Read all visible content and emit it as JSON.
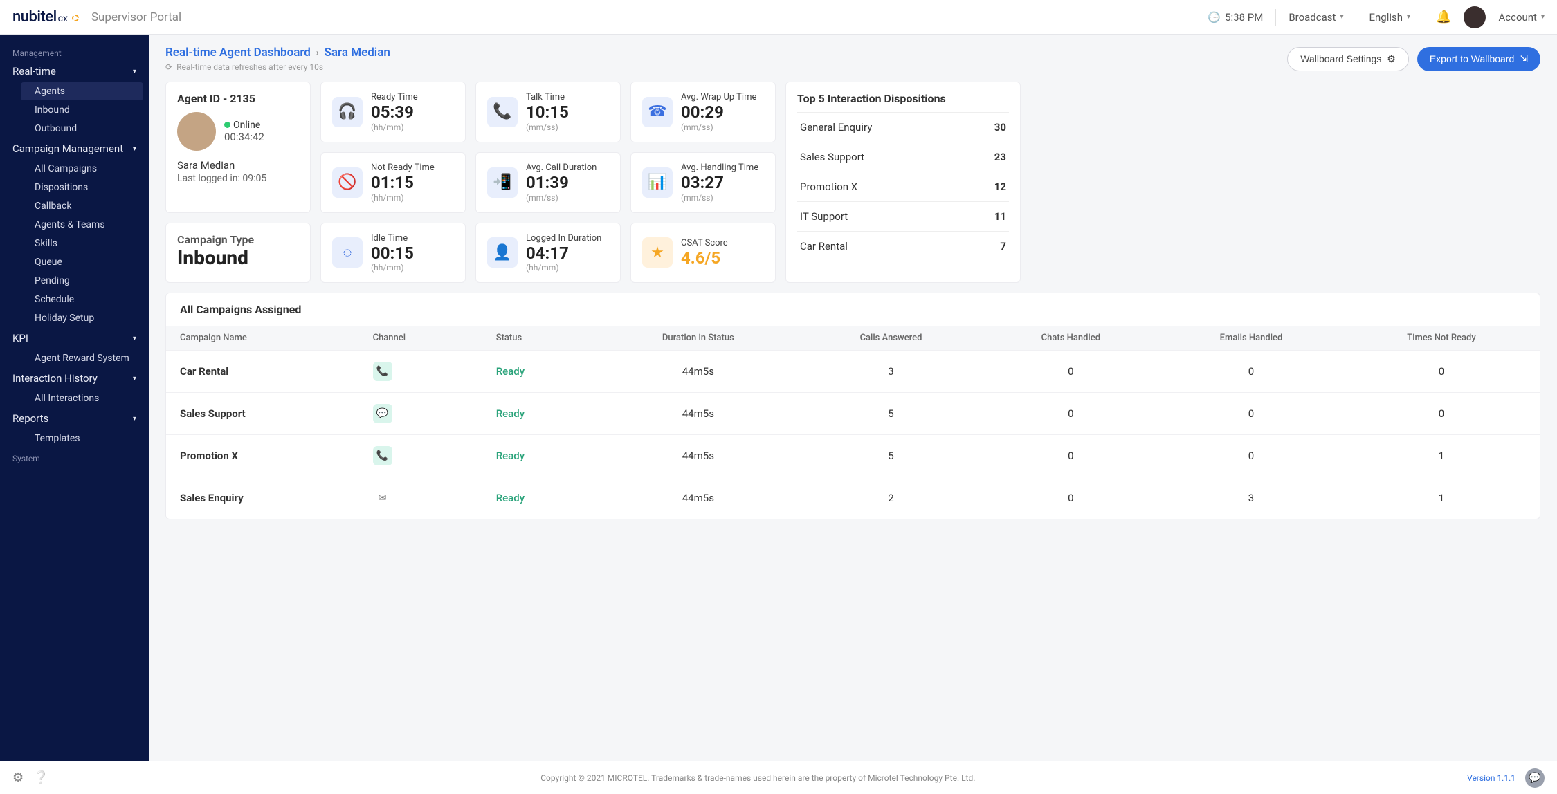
{
  "brand": {
    "name": "nubitel",
    "suffix": "cx"
  },
  "portal_name": "Supervisor Portal",
  "topbar": {
    "time": "5:38 PM",
    "broadcast": "Broadcast",
    "language": "English",
    "account": "Account"
  },
  "sidebar": {
    "section_management": "Management",
    "realtime": {
      "label": "Real-time",
      "items": [
        "Agents",
        "Inbound",
        "Outbound"
      ]
    },
    "campaign_mgmt": {
      "label": "Campaign Management",
      "items": [
        "All Campaigns",
        "Dispositions",
        "Callback",
        "Agents & Teams",
        "Skills",
        "Queue",
        "Pending",
        "Schedule",
        "Holiday Setup"
      ]
    },
    "kpi": {
      "label": "KPI",
      "items": [
        "Agent Reward System"
      ]
    },
    "interaction_history": {
      "label": "Interaction History",
      "items": [
        "All Interactions"
      ]
    },
    "reports": {
      "label": "Reports",
      "items": [
        "Templates"
      ]
    },
    "section_system": "System"
  },
  "breadcrumb": {
    "root": "Real-time Agent Dashboard",
    "leaf": "Sara Median"
  },
  "refresh_note": "Real-time data refreshes after every 10s",
  "actions": {
    "wallboard_settings": "Wallboard Settings",
    "export": "Export to Wallboard"
  },
  "agent": {
    "id_label": "Agent ID - 2135",
    "status": "Online",
    "status_duration": "00:34:42",
    "name": "Sara Median",
    "last_logged_label": "Last logged in: 09:05"
  },
  "campaign_type": {
    "label": "Campaign Type",
    "value": "Inbound"
  },
  "metrics": {
    "ready": {
      "label": "Ready Time",
      "value": "05:39",
      "unit": "(hh/mm)"
    },
    "talk": {
      "label": "Talk Time",
      "value": "10:15",
      "unit": "(mm/ss)"
    },
    "wrap": {
      "label": "Avg. Wrap Up Time",
      "value": "00:29",
      "unit": "(mm/ss)"
    },
    "notready": {
      "label": "Not Ready Time",
      "value": "01:15",
      "unit": "(hh/mm)"
    },
    "avgcall": {
      "label": "Avg. Call Duration",
      "value": "01:39",
      "unit": "(mm/ss)"
    },
    "avghandling": {
      "label": "Avg. Handling Time",
      "value": "03:27",
      "unit": "(mm/ss)"
    },
    "idle": {
      "label": "Idle Time",
      "value": "00:15",
      "unit": "(hh/mm)"
    },
    "loggedin": {
      "label": "Logged In Duration",
      "value": "04:17",
      "unit": "(hh/mm)"
    },
    "csat": {
      "label": "CSAT Score",
      "value": "4.6/5"
    }
  },
  "dispositions": {
    "title": "Top 5 Interaction Dispositions",
    "rows": [
      {
        "label": "General Enquiry",
        "value": "30"
      },
      {
        "label": "Sales Support",
        "value": "23"
      },
      {
        "label": "Promotion X",
        "value": "12"
      },
      {
        "label": "IT Support",
        "value": "11"
      },
      {
        "label": "Car Rental",
        "value": "7"
      }
    ]
  },
  "campaigns_table": {
    "title": "All Campaigns Assigned",
    "columns": [
      "Campaign Name",
      "Channel",
      "Status",
      "Duration in Status",
      "Calls Answered",
      "Chats Handled",
      "Emails Handled",
      "Times Not Ready"
    ],
    "rows": [
      {
        "name": "Car Rental",
        "channel": "phone",
        "status": "Ready",
        "duration": "44m5s",
        "calls": "3",
        "chats": "0",
        "emails": "0",
        "notready": "0"
      },
      {
        "name": "Sales Support",
        "channel": "chat",
        "status": "Ready",
        "duration": "44m5s",
        "calls": "5",
        "chats": "0",
        "emails": "0",
        "notready": "0"
      },
      {
        "name": "Promotion X",
        "channel": "phone",
        "status": "Ready",
        "duration": "44m5s",
        "calls": "5",
        "chats": "0",
        "emails": "0",
        "notready": "1"
      },
      {
        "name": "Sales Enquiry",
        "channel": "email",
        "status": "Ready",
        "duration": "44m5s",
        "calls": "2",
        "chats": "0",
        "emails": "3",
        "notready": "1"
      }
    ]
  },
  "footer": {
    "copyright": "Copyright © 2021 MICROTEL. Trademarks & trade-names used herein are the property of Microtel Technology Pte. Ltd.",
    "version": "Version 1.1.1"
  }
}
